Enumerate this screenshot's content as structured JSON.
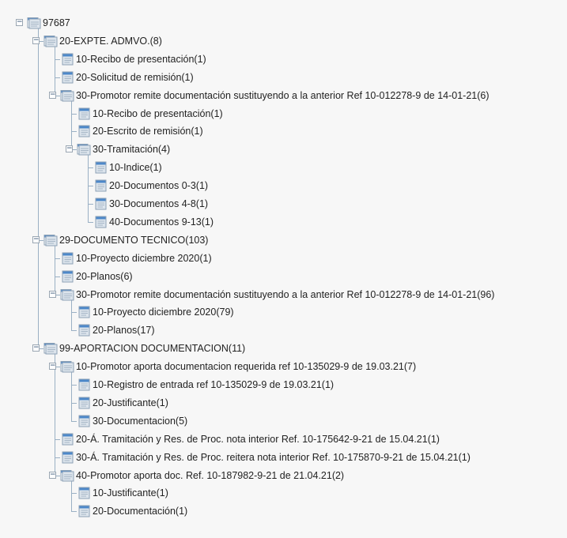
{
  "tree": {
    "label": "97687",
    "children": [
      {
        "label": "20-EXPTE. ADMVO.(8)",
        "children": [
          {
            "label": "10-Recibo de presentación(1)"
          },
          {
            "label": "20-Solicitud de remisión(1)"
          },
          {
            "label": "30-Promotor remite documentación sustituyendo a la anterior Ref 10-012278-9 de 14-01-21(6)",
            "children": [
              {
                "label": "10-Recibo de presentación(1)"
              },
              {
                "label": "20-Escrito de remisión(1)"
              },
              {
                "label": "30-Tramitación(4)",
                "children": [
                  {
                    "label": "10-Indice(1)"
                  },
                  {
                    "label": "20-Documentos 0-3(1)"
                  },
                  {
                    "label": "30-Documentos 4-8(1)"
                  },
                  {
                    "label": "40-Documentos 9-13(1)"
                  }
                ]
              }
            ]
          }
        ]
      },
      {
        "label": "29-DOCUMENTO TECNICO(103)",
        "children": [
          {
            "label": "10-Proyecto diciembre 2020(1)"
          },
          {
            "label": "20-Planos(6)"
          },
          {
            "label": "30-Promotor remite documentación sustituyendo a la anterior Ref 10-012278-9 de 14-01-21(96)",
            "children": [
              {
                "label": "10-Proyecto diciembre 2020(79)"
              },
              {
                "label": "20-Planos(17)"
              }
            ]
          }
        ]
      },
      {
        "label": "99-APORTACION DOCUMENTACION(11)",
        "children": [
          {
            "label": "10-Promotor aporta documentacion requerida ref 10-135029-9 de 19.03.21(7)",
            "children": [
              {
                "label": "10-Registro de entrada ref 10-135029-9 de 19.03.21(1)"
              },
              {
                "label": "20-Justificante(1)"
              },
              {
                "label": "30-Documentacion(5)"
              }
            ]
          },
          {
            "label": "20-Á. Tramitación y Res. de Proc. nota interior Ref. 10-175642-9-21 de 15.04.21(1)"
          },
          {
            "label": "30-Á. Tramitación y Res. de Proc. reitera nota interior Ref. 10-175870-9-21 de 15.04.21(1)"
          },
          {
            "label": "40-Promotor aporta doc. Ref. 10-187982-9-21 de 21.04.21(2)",
            "children": [
              {
                "label": "10-Justificante(1)"
              },
              {
                "label": "20-Documentación(1)"
              }
            ]
          }
        ]
      }
    ]
  },
  "icons": {
    "folder": "folder-icon",
    "document": "document-icon",
    "expanded_toggle": "collapse-toggle-icon"
  },
  "colors": {
    "line": "#9ab0c4",
    "folder_tab": "#4d88c9",
    "folder_body": "#dce4ec",
    "text": "#222222"
  }
}
